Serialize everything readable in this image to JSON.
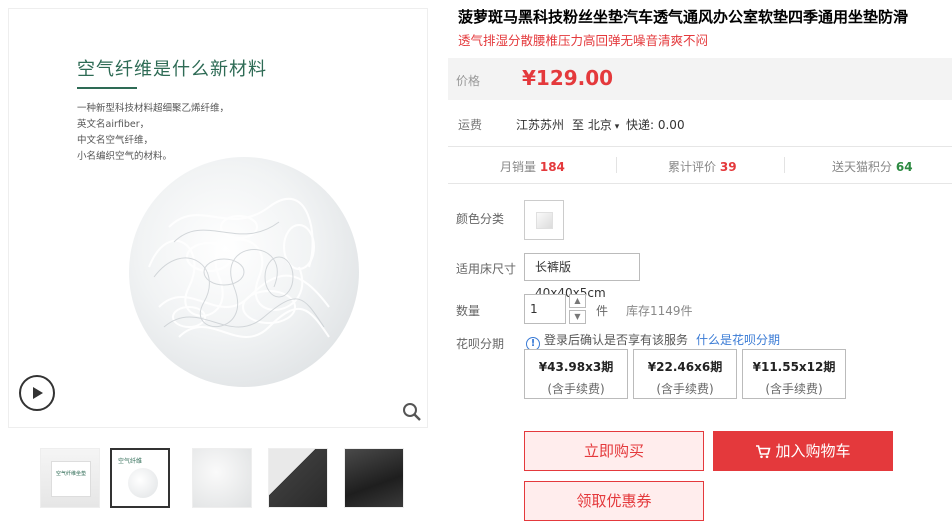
{
  "gallery": {
    "image_title": "空气纤维是什么新材料",
    "image_desc_lines": [
      "一种新型科技材料超细聚乙烯纤维，",
      "英文名airfiber，",
      "中文名空气纤维，",
      "小名编织空气的材料。"
    ],
    "thumbs": [
      {
        "icon": "product-package-thumbnail",
        "thumb_text": "空气纤维坐垫",
        "active": false
      },
      {
        "icon": "material-info-thumbnail",
        "thumb_text": "空气纤维",
        "active": true
      },
      {
        "icon": "fiber-closeup-thumbnail",
        "active": false
      },
      {
        "icon": "seat-usage-thumbnail",
        "active": false
      },
      {
        "icon": "car-seat-thumbnail",
        "active": false
      }
    ]
  },
  "product": {
    "title": "菠萝斑马黑科技粉丝坐垫汽车透气通风办公室软垫四季通用坐垫防滑",
    "subtitle": "透气排湿分散腰椎压力高回弹无噪音清爽不闷"
  },
  "price": {
    "label": "价格",
    "value": "¥129.00"
  },
  "shipping": {
    "label": "运费",
    "from": "江苏苏州",
    "to_prefix": "至",
    "to": "北京",
    "fee": "快递: 0.00"
  },
  "stats": {
    "monthly_sales_label": "月销量",
    "monthly_sales_value": "184",
    "reviews_label": "累计评价",
    "reviews_value": "39",
    "points_label": "送天猫积分",
    "points_value": "64"
  },
  "options": {
    "color_label": "颜色分类",
    "size_label": "适用床尺寸",
    "size_value": "长裤版40x40x5cm",
    "qty_label": "数量",
    "qty_value": "1",
    "qty_unit": "件",
    "stock": "库存1149件"
  },
  "huabei": {
    "label": "花呗分期",
    "info": "登录后确认是否享有该服务",
    "link": "什么是花呗分期",
    "plans": [
      {
        "amount": "¥43.98x3期",
        "fee": "(含手续费)"
      },
      {
        "amount": "¥22.46x6期",
        "fee": "(含手续费)"
      },
      {
        "amount": "¥11.55x12期",
        "fee": "(含手续费)"
      }
    ]
  },
  "actions": {
    "buy_now": "立即购买",
    "add_to_cart": "加入购物车",
    "coupon": "领取优惠券"
  },
  "colors": {
    "accent": "#e4393c",
    "green": "#2d8a42",
    "link": "#3a7bd5"
  }
}
